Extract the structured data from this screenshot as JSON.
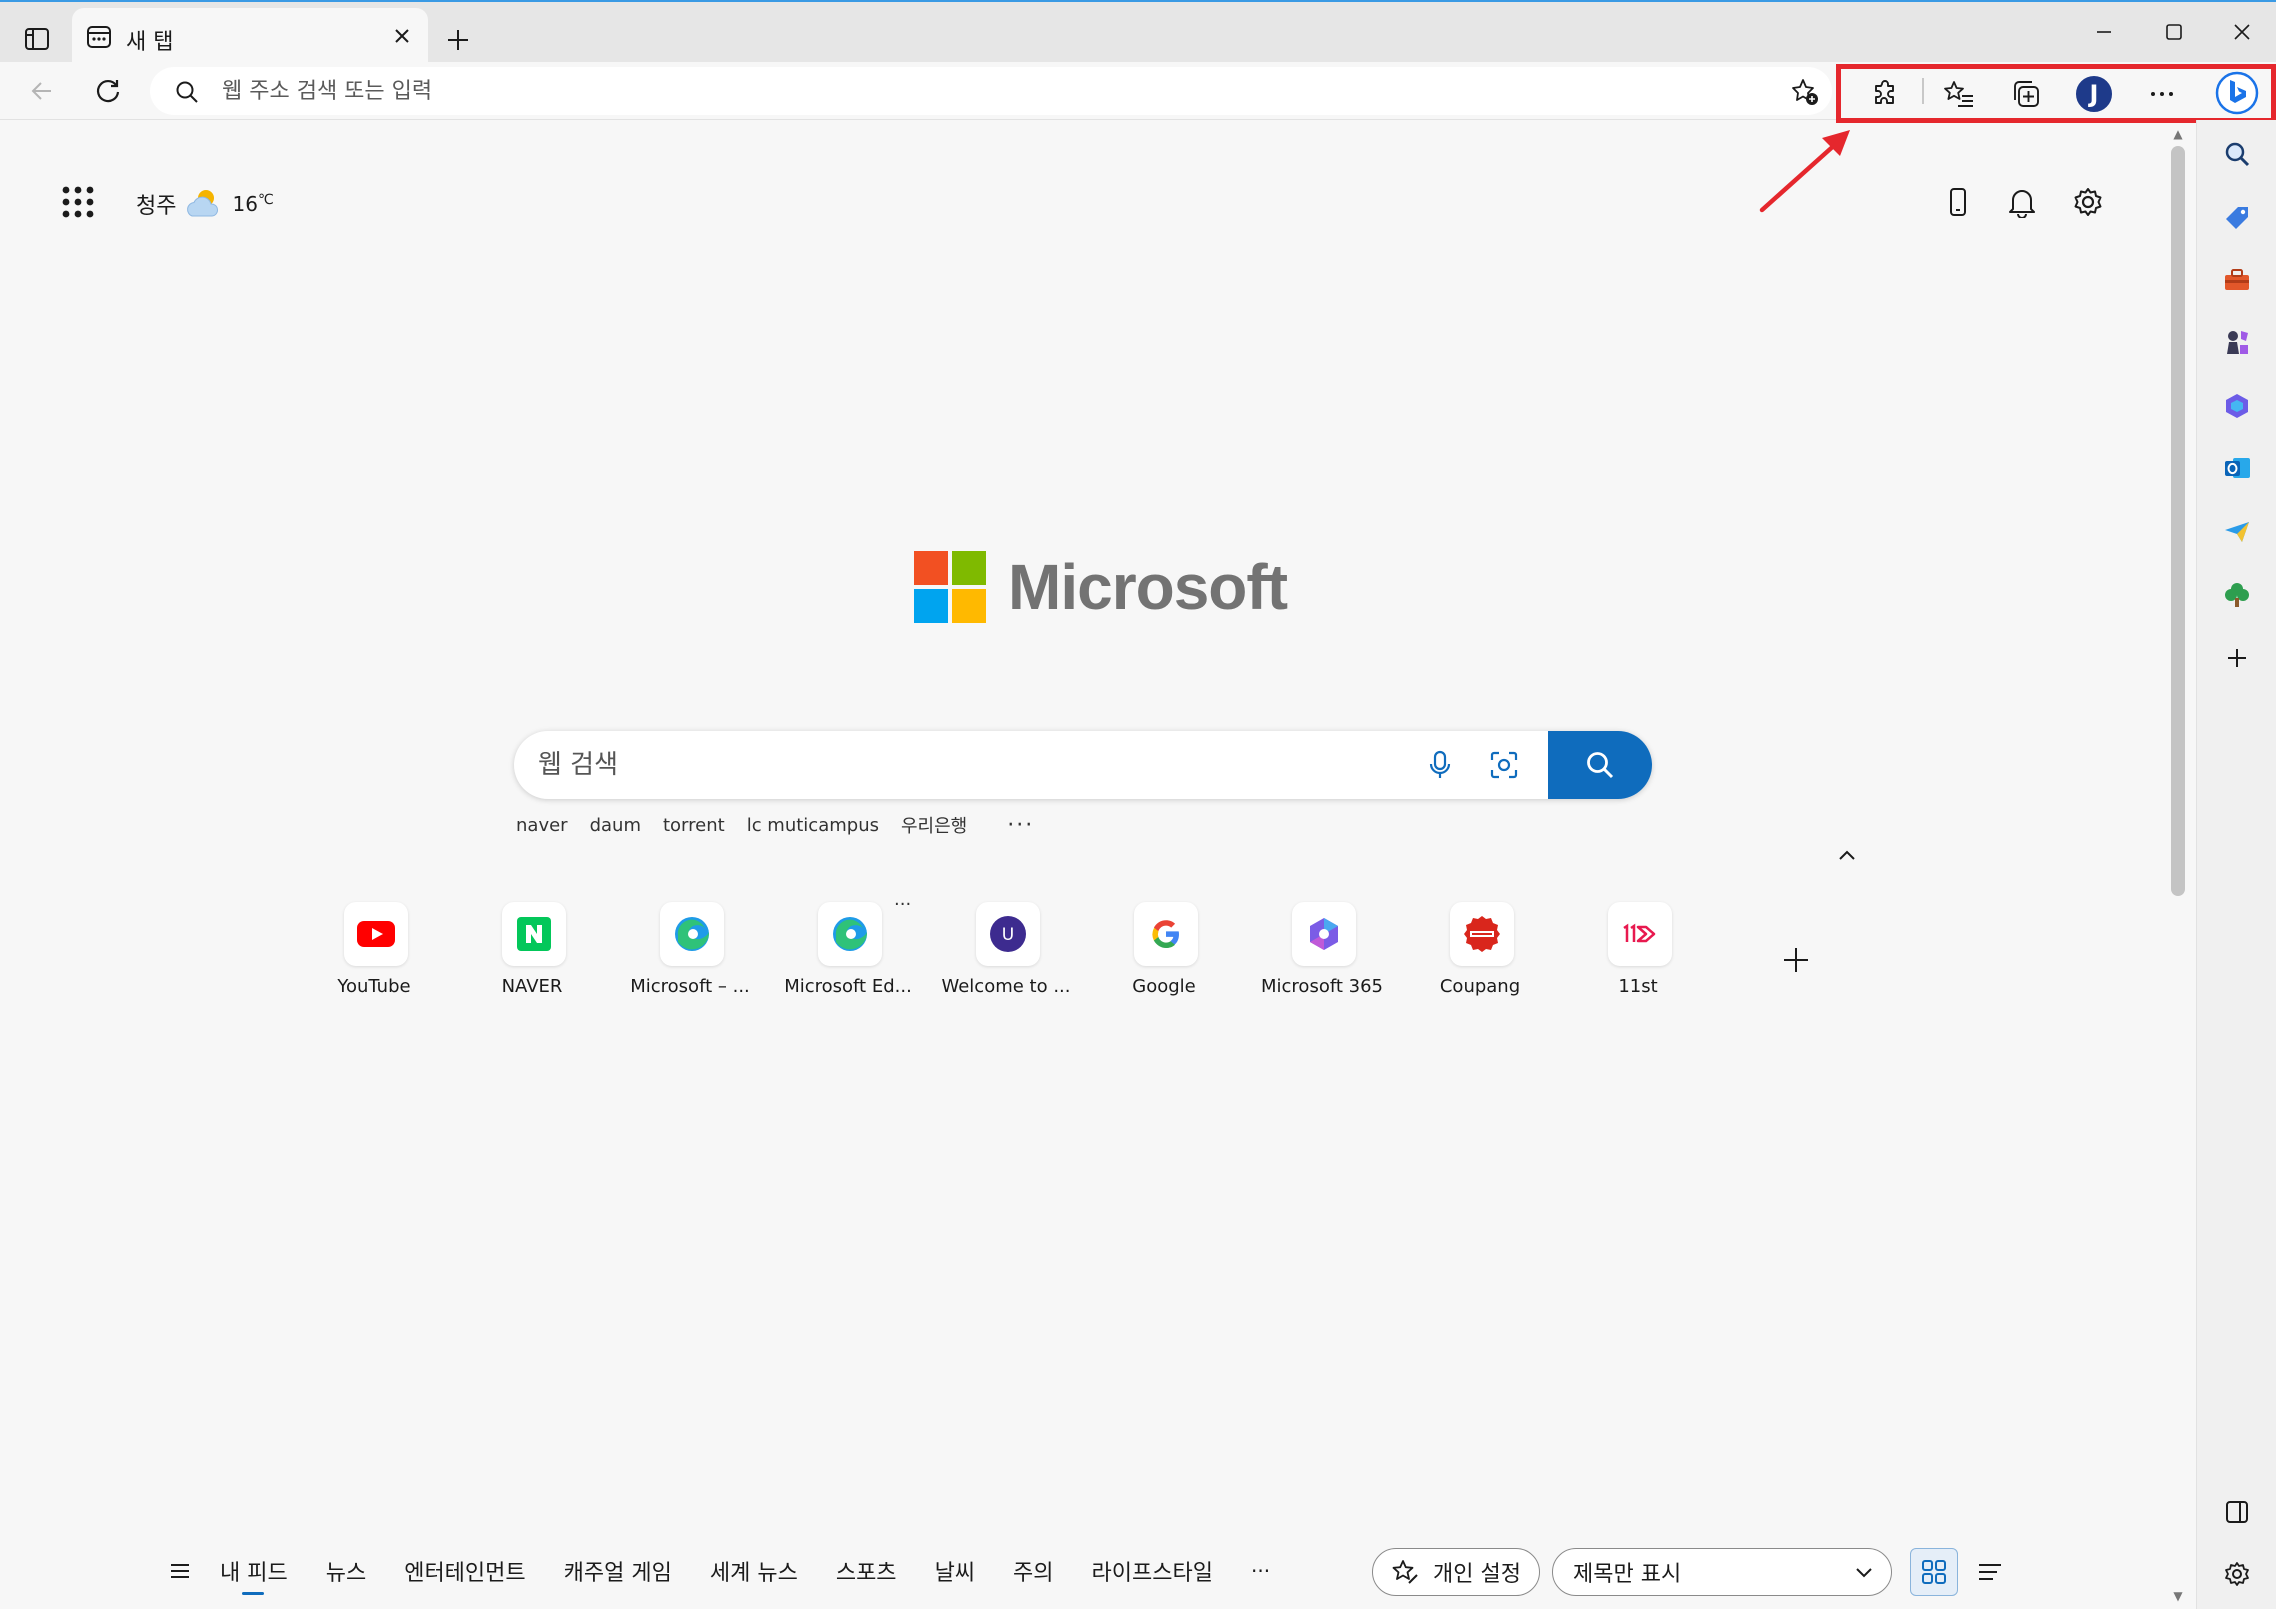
{
  "tab": {
    "title": "새 탭"
  },
  "address_bar": {
    "placeholder": "웹 주소 검색 또는 입력"
  },
  "profile": {
    "initial": "J"
  },
  "weather": {
    "city": "청주",
    "temperature": "16",
    "unit": "℃",
    "condition_icon": "partly-cloudy-icon"
  },
  "logo": {
    "wordmark": "Microsoft"
  },
  "search": {
    "placeholder": "웹 검색",
    "quick_links": [
      "naver",
      "daum",
      "torrent",
      "lc muticampus",
      "우리은행"
    ],
    "more": "···"
  },
  "top_sites": [
    {
      "label": "YouTube",
      "icon": "youtube-icon"
    },
    {
      "label": "NAVER",
      "icon": "naver-icon"
    },
    {
      "label": "Microsoft – ...",
      "icon": "edge-icon"
    },
    {
      "label": "Microsoft Ed...",
      "icon": "edge-icon"
    },
    {
      "label": "Welcome to ...",
      "icon": "u-icon"
    },
    {
      "label": "Google",
      "icon": "google-icon"
    },
    {
      "label": "Microsoft 365",
      "icon": "m365-icon"
    },
    {
      "label": "Coupang",
      "icon": "coupang-icon"
    },
    {
      "label": "11st",
      "icon": "11st-icon"
    }
  ],
  "feed": {
    "items": [
      "내 피드",
      "뉴스",
      "엔터테인먼트",
      "캐주얼 게임",
      "세계 뉴스",
      "스포츠",
      "날씨",
      "주의",
      "라이프스타일"
    ],
    "more": "···",
    "personalize_label": "개인 설정",
    "view_mode_label": "제목만 표시"
  },
  "colors": {
    "accent": "#0f6cbd",
    "highlight": "#e5272d"
  }
}
